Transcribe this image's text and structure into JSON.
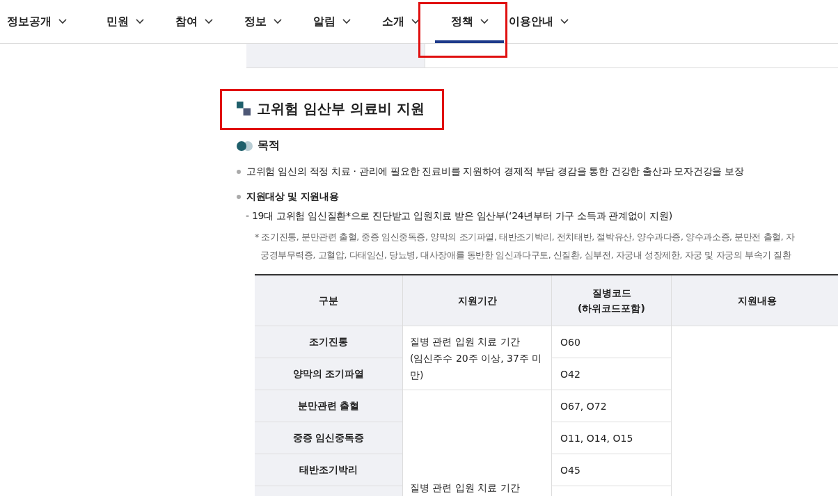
{
  "nav": {
    "items": [
      {
        "label": "정보공개",
        "selected": false,
        "highlighted": false
      },
      {
        "label": "민원",
        "selected": false,
        "highlighted": false
      },
      {
        "label": "참여",
        "selected": false,
        "highlighted": false
      },
      {
        "label": "정보",
        "selected": false,
        "highlighted": false
      },
      {
        "label": "알림",
        "selected": false,
        "highlighted": false
      },
      {
        "label": "소개",
        "selected": false,
        "highlighted": false
      },
      {
        "label": "정책",
        "selected": true,
        "highlighted": true
      },
      {
        "label": "이용안내",
        "selected": false,
        "highlighted": false
      }
    ]
  },
  "heading": {
    "title": "고위험 임산부 의료비 지원",
    "highlighted": true
  },
  "section": {
    "title": "목적"
  },
  "bullets": [
    {
      "text": "고위험 임신의 적정 치료 · 관리에 필요한 진료비를 지원하여 경제적 부담 경감을 통한 건강한 출산과 모자건강을 보장",
      "bold": false
    },
    {
      "text": "지원대상 및 지원내용",
      "bold": true
    }
  ],
  "sub_item": "- 19대 고위험 임신질환*으로 진단받고 입원치료 받은 임산부(‘24년부터 가구 소득과 관계없이 지원)",
  "footnote": "* 조기진통, 분만관련 출혈, 중증 임신중독증, 양막의 조기파열, 태반조기박리, 전치태반, 절박유산, 양수과다증, 양수과소증, 분만전 출혈, 자궁경부무력증, 고혈압, 다태임신, 당뇨병, 대사장애를 동반한 임신과다구토, 신질환, 심부전, 자궁내 성장제한, 자궁 및 자궁의 부속기 질환",
  "table": {
    "columns": [
      "구분",
      "지원기간",
      "질병코드\n(하위코드포함)",
      "지원내용"
    ],
    "groups": [
      {
        "period": "질병 관련 입원 치료 기간\n(임신주수 20주 이상, 37주 미만)",
        "rows": [
          {
            "category": "조기진통",
            "code": "O60"
          },
          {
            "category": "양막의 조기파열",
            "code": "O42"
          }
        ]
      },
      {
        "period": "질병 관련 입원 치료 기간",
        "rows": [
          {
            "category": "분만관련 출혈",
            "code": "O67, O72"
          },
          {
            "category": "중증 임신중독증",
            "code": "O11, O14, O15"
          },
          {
            "category": "태반조기박리",
            "code": "O45"
          }
        ]
      }
    ]
  }
}
